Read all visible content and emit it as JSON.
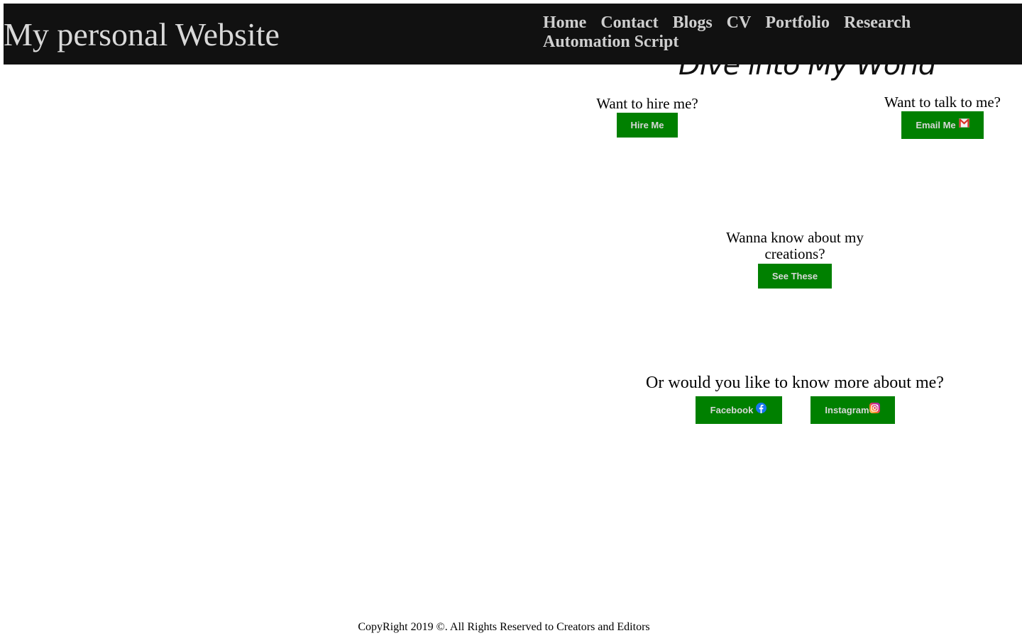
{
  "header": {
    "site_title": "My personal Website",
    "nav": [
      "Home",
      "Contact",
      "Blogs",
      "CV",
      "Portfolio",
      "Research",
      "Automation Script"
    ]
  },
  "hero": {
    "title": "Dive into My World"
  },
  "hire": {
    "prompt": "Want to hire me?",
    "button": "Hire Me"
  },
  "talk": {
    "prompt": "Want to talk to me?",
    "button": "Email Me",
    "icon": "gmail-icon"
  },
  "creations": {
    "prompt": "Wanna know about my creations?",
    "button": "See These"
  },
  "about": {
    "prompt": "Or would you like to know more about me?",
    "facebook_button": "Facebook",
    "facebook_icon": "facebook-icon",
    "instagram_button": "Instagram",
    "instagram_icon": "instagram-icon"
  },
  "footer": {
    "text": "CopyRight 2019 ©. All Rights Reserved to Creators and Editors"
  },
  "colors": {
    "header_bg": "#111111",
    "header_text": "#d9d9d9",
    "button_bg": "#008000",
    "button_text": "#d8d8d8"
  }
}
